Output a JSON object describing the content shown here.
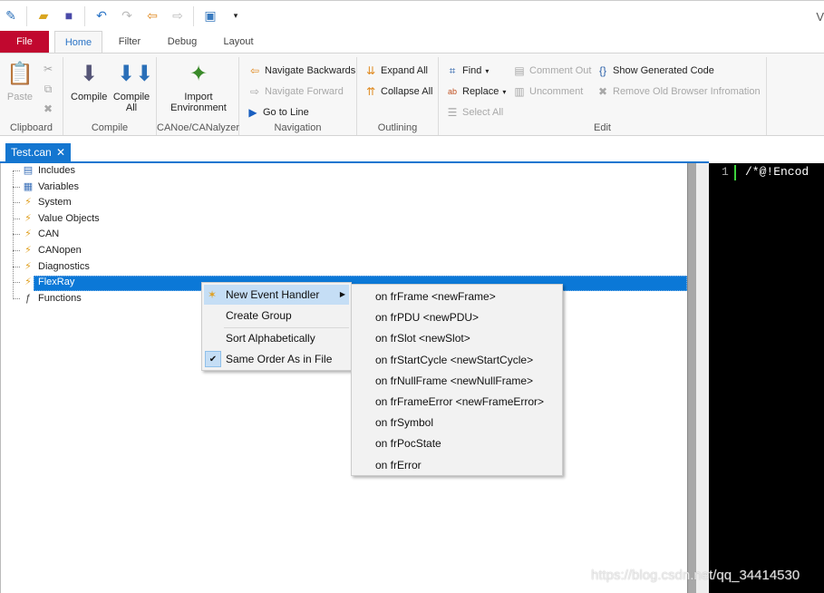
{
  "quick_access": {
    "icons": [
      "edit-icon",
      "open-folder-icon",
      "save-icon",
      "undo-icon",
      "redo-icon",
      "back-icon",
      "forward-icon",
      "window-icon",
      "customize-icon"
    ],
    "title_fragment": "V"
  },
  "tabs": [
    "File",
    "Home",
    "Filter",
    "Debug",
    "Layout"
  ],
  "ribbon": {
    "clipboard": {
      "label": "Clipboard",
      "paste": "Paste"
    },
    "compile": {
      "label": "Compile",
      "compile": "Compile",
      "compile_all_1": "Compile",
      "compile_all_2": "All"
    },
    "canoe": {
      "label": "CANoe/CANalyzer",
      "import_1": "Import",
      "import_2": "Environment"
    },
    "navigation": {
      "label": "Navigation",
      "back": "Navigate Backwards",
      "forward": "Navigate Forward",
      "goto": "Go to Line"
    },
    "outlining": {
      "label": "Outlining",
      "expand": "Expand All",
      "collapse": "Collapse All"
    },
    "edit": {
      "label": "Edit",
      "find": "Find",
      "replace": "Replace",
      "select_all": "Select All",
      "comment": "Comment Out",
      "uncomment": "Uncomment",
      "show_code": "Show Generated Code",
      "remove_info": "Remove Old Browser Infromation"
    }
  },
  "doc_tab": {
    "title": "Test.can",
    "close": "✕"
  },
  "tree": [
    "Includes",
    "Variables",
    "System",
    "Value Objects",
    "CAN",
    "CANopen",
    "Diagnostics",
    "FlexRay",
    "Functions"
  ],
  "selected_item": "FlexRay",
  "context_menu": {
    "new_handler": "New Event Handler",
    "create_group": "Create Group",
    "sort": "Sort Alphabetically",
    "same_order": "Same Order As in File",
    "checked": "Same Order As in File"
  },
  "submenu": [
    "on frFrame <newFrame>",
    "on frPDU <newPDU>",
    "on frSlot <newSlot>",
    "on frStartCycle <newStartCycle>",
    "on frNullFrame <newNullFrame>",
    "on frFrameError <newFrameError>",
    "on frSymbol",
    "on frPocState",
    "on frError"
  ],
  "editor": {
    "line_number": "1",
    "code": "/*@!Encod"
  },
  "watermark": "https://blog.csdn.net/qq_34414530",
  "colors": {
    "file_tab": "#c1082f",
    "accent": "#1476d0",
    "selection": "#0b78d7",
    "menu_highlight": "#c5def5"
  }
}
